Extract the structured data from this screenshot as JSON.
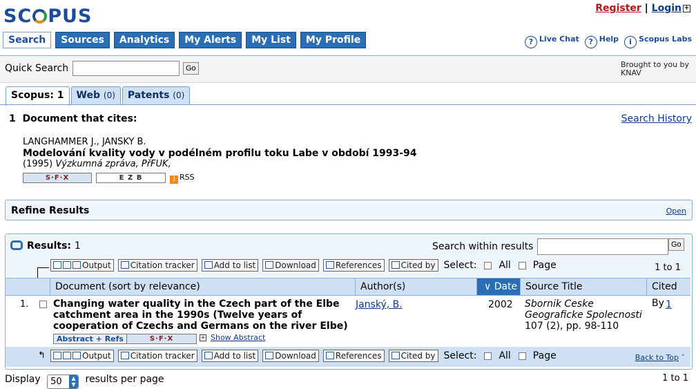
{
  "header": {
    "logo": "SCOPUS",
    "register": "Register",
    "separator": "|",
    "login": "Login",
    "nav": [
      "Search",
      "Sources",
      "Analytics",
      "My Alerts",
      "My List",
      "My Profile"
    ],
    "utilities": [
      "Live Chat",
      "Help",
      "Scopus Labs"
    ]
  },
  "quick_search": {
    "label": "Quick Search",
    "value": "",
    "go": "Go",
    "brought_by_line1": "Brought to you by",
    "brought_by_line2": "KNAV"
  },
  "result_tabs": [
    {
      "label": "Scopus: 1",
      "count": ""
    },
    {
      "label": "Web",
      "count": "(0)"
    },
    {
      "label": "Patents",
      "count": "(0)"
    }
  ],
  "cites_heading": "1  Document that cites:",
  "search_history": "Search History",
  "cited_document": {
    "authors": "LANGHAMMER J., JANSKY B.",
    "title": "Modelování kvality vody v podélném profilu toku Labe v období 1993-94",
    "year": "(1995)",
    "source": "Výzkumná zpráva, PřFUK,",
    "sfx": "S·F·X",
    "ezb": "E Z B",
    "rss": "RSS"
  },
  "refine": {
    "title": "Refine Results",
    "open": "Open"
  },
  "results": {
    "label": "Results:",
    "count": "1",
    "search_within_label": "Search within results",
    "search_within_value": "",
    "go": "Go",
    "toolbar": [
      "Output",
      "Citation tracker",
      "Add to list",
      "Download",
      "References",
      "Cited by"
    ],
    "select_label": "Select:",
    "all_label": "All",
    "page_label": "Page",
    "range": "1 to 1",
    "columns": [
      "Document (sort by relevance)",
      "Author(s)",
      "Date",
      "Source Title",
      "Cited By"
    ],
    "rows": [
      {
        "num": "1.",
        "title": "Changing water quality in the Czech part of the Elbe catchment area in the 1990s (Twelve years of cooperation of Czechs and Germans on the river Elbe)",
        "author": "Janský, B.",
        "date": "2002",
        "source_title": "Sbornik Ceske Geograficke Spolecnosti",
        "source_detail": "107 (2), pp. 98-110",
        "cited_by": "1",
        "abstract_refs": "Abstract + Refs",
        "sfx": "S·F·X",
        "show_abstract": "Show Abstract"
      }
    ],
    "back_to_top": "Back to Top"
  },
  "footer": {
    "display_label": "Display",
    "per_page": "50",
    "per_page_suffix": "results per page",
    "range": "1 to 1"
  },
  "colors": {
    "brand": "#1d4d9a",
    "nav": "#2a6fb5",
    "header_row": "#cfe0f3",
    "register": "#b31717"
  }
}
